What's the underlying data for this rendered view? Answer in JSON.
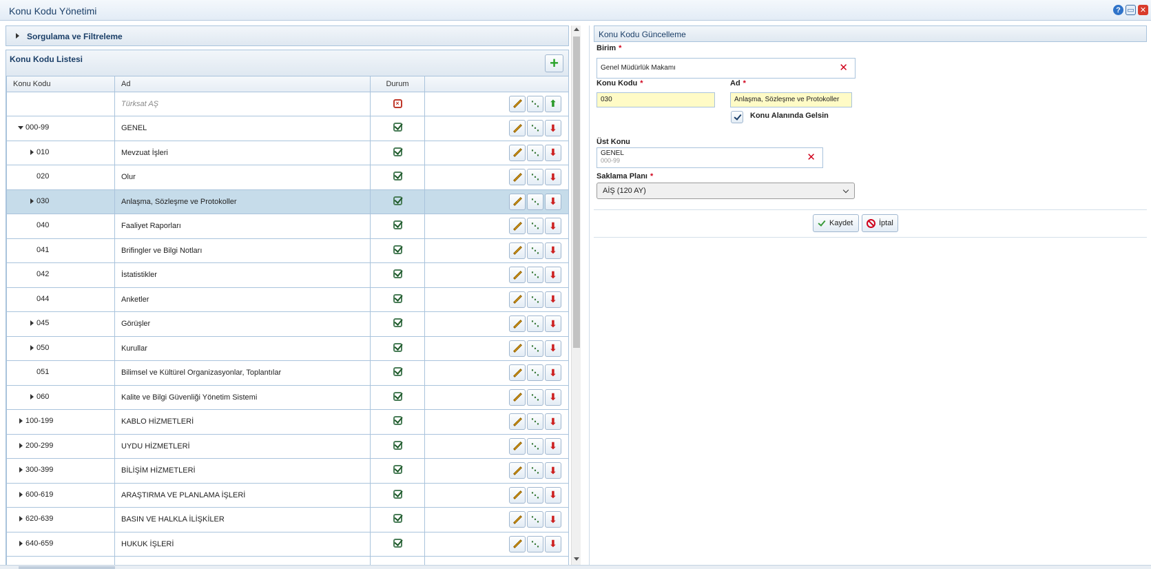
{
  "window": {
    "title": "Konu Kodu Yönetimi"
  },
  "filter": {
    "label": "Sorgulama ve Filtreleme"
  },
  "list": {
    "title": "Konu Kodu Listesi",
    "columns": {
      "code": "Konu Kodu",
      "name": "Ad",
      "status": "Durum"
    },
    "rows": [
      {
        "code": "",
        "name": "Türksat AŞ",
        "level": 0,
        "expander": "none",
        "status": "passive",
        "selected": false,
        "root": true
      },
      {
        "code": "000-99",
        "name": "GENEL",
        "level": 1,
        "expander": "open",
        "status": "active",
        "selected": false
      },
      {
        "code": "010",
        "name": "Mevzuat İşleri",
        "level": 2,
        "expander": "closed",
        "status": "active",
        "selected": false
      },
      {
        "code": "020",
        "name": "Olur",
        "level": 2,
        "expander": "none",
        "status": "active",
        "selected": false
      },
      {
        "code": "030",
        "name": "Anlaşma, Sözleşme ve Protokoller",
        "level": 2,
        "expander": "closed",
        "status": "active",
        "selected": true
      },
      {
        "code": "040",
        "name": "Faaliyet Raporları",
        "level": 2,
        "expander": "none",
        "status": "active",
        "selected": false
      },
      {
        "code": "041",
        "name": "Brifingler ve Bilgi Notları",
        "level": 2,
        "expander": "none",
        "status": "active",
        "selected": false
      },
      {
        "code": "042",
        "name": "İstatistikler",
        "level": 2,
        "expander": "none",
        "status": "active",
        "selected": false
      },
      {
        "code": "044",
        "name": "Anketler",
        "level": 2,
        "expander": "none",
        "status": "active",
        "selected": false
      },
      {
        "code": "045",
        "name": "Görüşler",
        "level": 2,
        "expander": "closed",
        "status": "active",
        "selected": false
      },
      {
        "code": "050",
        "name": "Kurullar",
        "level": 2,
        "expander": "closed",
        "status": "active",
        "selected": false
      },
      {
        "code": "051",
        "name": "Bilimsel ve Kültürel Organizasyonlar, Toplantılar",
        "level": 2,
        "expander": "none",
        "status": "active",
        "selected": false
      },
      {
        "code": "060",
        "name": "Kalite ve Bilgi Güvenliği Yönetim Sistemi",
        "level": 2,
        "expander": "closed",
        "status": "active",
        "selected": false
      },
      {
        "code": "100-199",
        "name": "KABLO HİZMETLERİ",
        "level": 1,
        "expander": "closed",
        "status": "active",
        "selected": false
      },
      {
        "code": "200-299",
        "name": "UYDU HİZMETLERİ",
        "level": 1,
        "expander": "closed",
        "status": "active",
        "selected": false
      },
      {
        "code": "300-399",
        "name": "BİLİŞİM HİZMETLERİ",
        "level": 1,
        "expander": "closed",
        "status": "active",
        "selected": false
      },
      {
        "code": "600-619",
        "name": "ARAŞTIRMA VE PLANLAMA İŞLERİ",
        "level": 1,
        "expander": "closed",
        "status": "active",
        "selected": false
      },
      {
        "code": "620-639",
        "name": "BASIN VE HALKLA İLİŞKİLER",
        "level": 1,
        "expander": "closed",
        "status": "active",
        "selected": false
      },
      {
        "code": "640-659",
        "name": "HUKUK İŞLERİ",
        "level": 1,
        "expander": "closed",
        "status": "active",
        "selected": false
      },
      {
        "code": "",
        "name": "",
        "level": 1,
        "expander": "none",
        "status": "active",
        "selected": false,
        "partial": true
      }
    ]
  },
  "form": {
    "title": "Konu Kodu Güncelleme",
    "birim": {
      "label": "Birim",
      "value": "Genel Müdürlük Makamı"
    },
    "konu_kodu": {
      "label": "Konu Kodu",
      "value": "030"
    },
    "ad": {
      "label": "Ad",
      "value": "Anlaşma, Sözleşme ve Protokoller"
    },
    "checkbox": {
      "label": "Konu Alanında Gelsin",
      "checked": true
    },
    "ust_konu": {
      "label": "Üst Konu",
      "name": "GENEL",
      "code": "000-99"
    },
    "saklama": {
      "label": "Saklama Planı",
      "selected": "AİŞ (120 AY)"
    },
    "save_label": "Kaydet",
    "cancel_label": "İptal",
    "required_mark": "*"
  },
  "colors": {
    "accent": "#1b3f68",
    "selected_row": "#c6dcea",
    "required": "#d0021b",
    "input_highlight": "#fffbc6"
  }
}
